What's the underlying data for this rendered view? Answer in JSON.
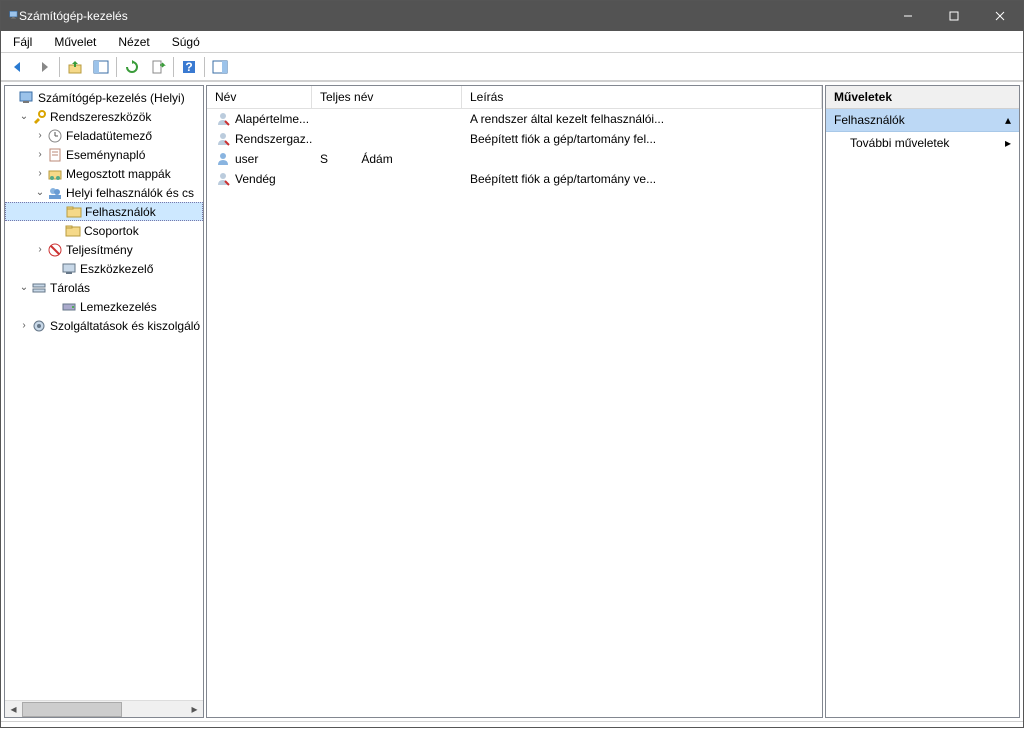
{
  "window": {
    "title": "Számítógép-kezelés"
  },
  "menu": {
    "file": "Fájl",
    "action": "Művelet",
    "view": "Nézet",
    "help": "Súgó"
  },
  "tree": {
    "root": "Számítógép-kezelés (Helyi)",
    "systools": "Rendszereszközök",
    "taskscheduler": "Feladatütemező",
    "eventviewer": "Eseménynapló",
    "sharedfolders": "Megosztott mappák",
    "localusers": "Helyi felhasználók és cs",
    "users": "Felhasználók",
    "groups": "Csoportok",
    "performance": "Teljesítmény",
    "devmgr": "Eszközkezelő",
    "storage": "Tárolás",
    "diskmgmt": "Lemezkezelés",
    "services": "Szolgáltatások és kiszolgáló"
  },
  "columns": {
    "name": "Név",
    "fullname": "Teljes név",
    "desc": "Leírás"
  },
  "users": [
    {
      "name": "Alapértelme...",
      "fullname": "",
      "desc": "A rendszer által kezelt felhasználói..."
    },
    {
      "name": "Rendszergaz...",
      "fullname": "",
      "desc": "Beépített fiók a gép/tartomány fel..."
    },
    {
      "name": "user",
      "fullname": "S          Ádám",
      "desc": ""
    },
    {
      "name": "Vendég",
      "fullname": "",
      "desc": "Beépített fiók a gép/tartomány ve..."
    }
  ],
  "actions": {
    "header": "Műveletek",
    "selection": "Felhasználók",
    "more": "További műveletek"
  }
}
